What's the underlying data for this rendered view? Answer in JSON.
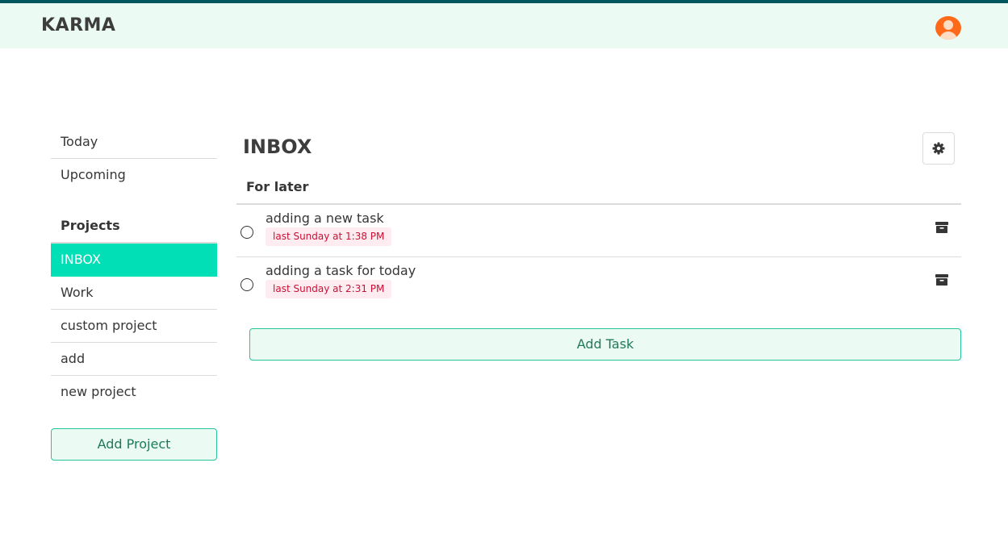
{
  "header": {
    "brand": "KARMA",
    "avatar_icon": "user-avatar-icon"
  },
  "sidebar": {
    "top_items": [
      {
        "label": "Today"
      },
      {
        "label": "Upcoming"
      }
    ],
    "projects_heading": "Projects",
    "projects": [
      {
        "label": "INBOX",
        "active": true
      },
      {
        "label": "Work"
      },
      {
        "label": "custom project"
      },
      {
        "label": "add"
      },
      {
        "label": "new project"
      }
    ],
    "add_project_label": "Add Project"
  },
  "main": {
    "title": "INBOX",
    "settings_icon": "gear-icon",
    "section_title": "For later",
    "tasks": [
      {
        "name": "adding a new task",
        "due": "last Sunday at 1:38 PM"
      },
      {
        "name": "adding a task for today",
        "due": "last Sunday at 2:31 PM"
      }
    ],
    "add_task_label": "Add Task"
  },
  "colors": {
    "accent": "#00dfb5",
    "navbar_bg": "#ebfaf3",
    "top_line": "#00585e",
    "due_tag_bg": "#feecf0",
    "due_tag_text": "#cc0f35",
    "avatar": "#ff6a1a"
  }
}
